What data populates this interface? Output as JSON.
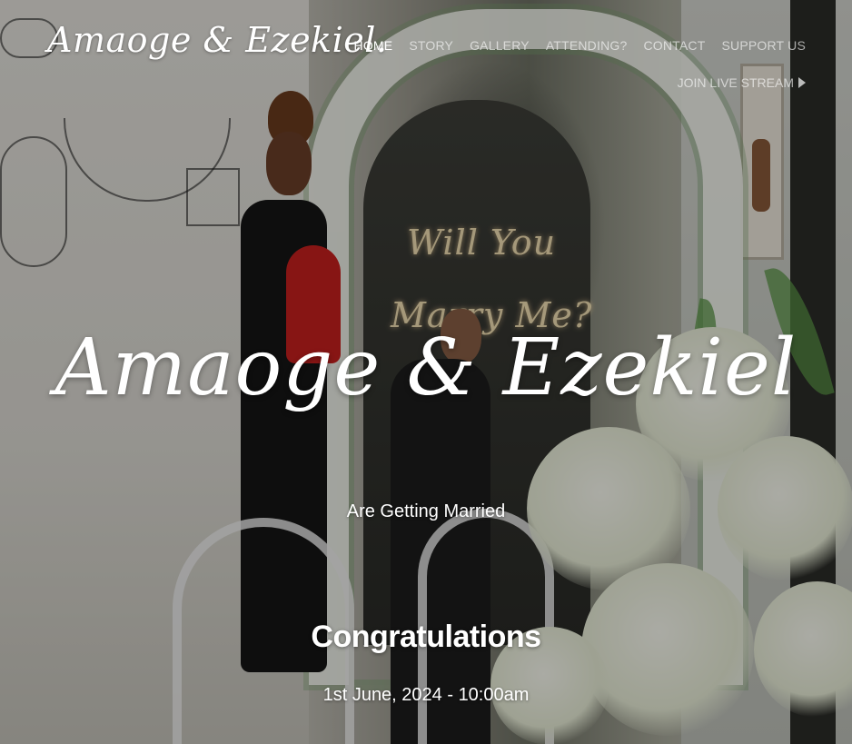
{
  "header": {
    "logo_text": "Amaoge & Ezekiel.",
    "nav": [
      {
        "label": "HOME",
        "active": true
      },
      {
        "label": "STORY",
        "active": false
      },
      {
        "label": "GALLERY",
        "active": false
      },
      {
        "label": "ATTENDING?",
        "active": false
      },
      {
        "label": "CONTACT",
        "active": false
      },
      {
        "label": "SUPPORT US",
        "active": false
      }
    ],
    "live_stream_label": "JOIN LIVE STREAM"
  },
  "hero": {
    "title": "Amaoge & Ezekiel",
    "subtitle": "Are Getting Married",
    "congrats": "Congratulations",
    "date": "1st June, 2024 - 10:00am"
  },
  "icons": {
    "live_stream": "play-icon"
  },
  "colors": {
    "text": "#ffffff",
    "nav_inactive": "rgba(255,255,255,0.62)",
    "bouquet": "#c8201e"
  }
}
